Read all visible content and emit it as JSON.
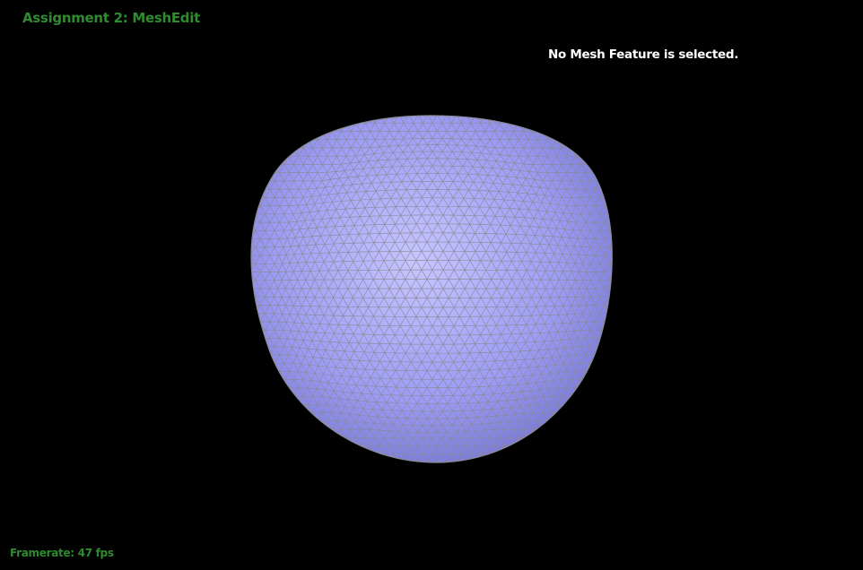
{
  "window": {
    "title": "Assignment 2: MeshEdit",
    "background_color": "#000000"
  },
  "hud": {
    "title_color": "#2e8b2e",
    "status_text": "No Mesh Feature is selected.",
    "status_color": "#ffffff",
    "framerate_label": "Framerate: 47 fps",
    "framerate_color": "#2e8b2e"
  },
  "mesh": {
    "name": "subdivided-sphere-mesh",
    "surface_color": "#9c9cf6",
    "highlight_color": "#c6c6ff",
    "shadow_color": "#7878d8",
    "wireframe_color": "#8a8a96"
  }
}
